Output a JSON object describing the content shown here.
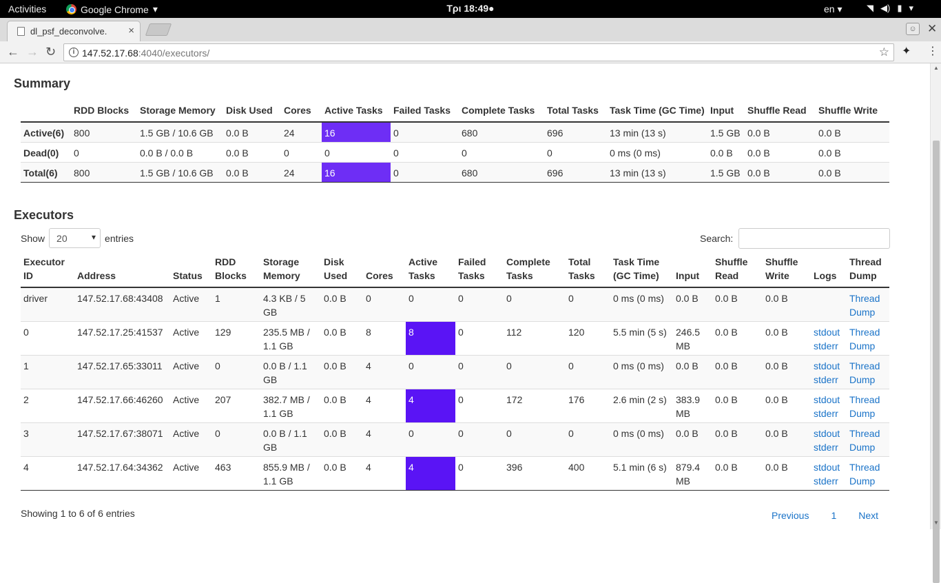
{
  "system": {
    "activities": "Activities",
    "app_name": "Google Chrome",
    "clock": "Τρι 18:49●",
    "language": "en"
  },
  "browser": {
    "tab_title": "dl_psf_deconvolve.",
    "url_host": "147.52.17.68",
    "url_rest": ":4040/executors/"
  },
  "summary": {
    "title": "Summary",
    "headers": [
      "",
      "RDD Blocks",
      "Storage Memory",
      "Disk Used",
      "Cores",
      "Active Tasks",
      "Failed Tasks",
      "Complete Tasks",
      "Total Tasks",
      "Task Time (GC Time)",
      "Input",
      "Shuffle Read",
      "Shuffle Write"
    ],
    "rows": [
      [
        "Active(6)",
        "800",
        "1.5 GB / 10.6 GB",
        "0.0 B",
        "24",
        "16",
        "0",
        "680",
        "696",
        "13 min (13 s)",
        "1.5 GB",
        "0.0 B",
        "0.0 B"
      ],
      [
        "Dead(0)",
        "0",
        "0.0 B / 0.0 B",
        "0.0 B",
        "0",
        "0",
        "0",
        "0",
        "0",
        "0 ms (0 ms)",
        "0.0 B",
        "0.0 B",
        "0.0 B"
      ],
      [
        "Total(6)",
        "800",
        "1.5 GB / 10.6 GB",
        "0.0 B",
        "24",
        "16",
        "0",
        "680",
        "696",
        "13 min (13 s)",
        "1.5 GB",
        "0.0 B",
        "0.0 B"
      ]
    ]
  },
  "executors": {
    "title": "Executors",
    "show_label": "Show",
    "entries_label": "entries",
    "page_size": "20",
    "search_label": "Search:",
    "headers": [
      "Executor ID",
      "Address",
      "Status",
      "RDD Blocks",
      "Storage Memory",
      "Disk Used",
      "Cores",
      "Active Tasks",
      "Failed Tasks",
      "Complete Tasks",
      "Total Tasks",
      "Task Time (GC Time)",
      "Input",
      "Shuffle Read",
      "Shuffle Write",
      "Logs",
      "Thread Dump"
    ],
    "rows": [
      [
        "driver",
        "147.52.17.68:43408",
        "Active",
        "1",
        "4.3 KB / 5 GB",
        "0.0 B",
        "0",
        "0",
        "0",
        "0",
        "0",
        "0 ms (0 ms)",
        "0.0 B",
        "0.0 B",
        "0.0 B",
        "",
        "Thread Dump"
      ],
      [
        "0",
        "147.52.17.25:41537",
        "Active",
        "129",
        "235.5 MB / 1.1 GB",
        "0.0 B",
        "8",
        "8",
        "0",
        "112",
        "120",
        "5.5 min (5 s)",
        "246.5 MB",
        "0.0 B",
        "0.0 B",
        "stdout stderr",
        "Thread Dump"
      ],
      [
        "1",
        "147.52.17.65:33011",
        "Active",
        "0",
        "0.0 B / 1.1 GB",
        "0.0 B",
        "4",
        "0",
        "0",
        "0",
        "0",
        "0 ms (0 ms)",
        "0.0 B",
        "0.0 B",
        "0.0 B",
        "stdout stderr",
        "Thread Dump"
      ],
      [
        "2",
        "147.52.17.66:46260",
        "Active",
        "207",
        "382.7 MB / 1.1 GB",
        "0.0 B",
        "4",
        "4",
        "0",
        "172",
        "176",
        "2.6 min (2 s)",
        "383.9 MB",
        "0.0 B",
        "0.0 B",
        "stdout stderr",
        "Thread Dump"
      ],
      [
        "3",
        "147.52.17.67:38071",
        "Active",
        "0",
        "0.0 B / 1.1 GB",
        "0.0 B",
        "4",
        "0",
        "0",
        "0",
        "0",
        "0 ms (0 ms)",
        "0.0 B",
        "0.0 B",
        "0.0 B",
        "stdout stderr",
        "Thread Dump"
      ],
      [
        "4",
        "147.52.17.64:34362",
        "Active",
        "463",
        "855.9 MB / 1.1 GB",
        "0.0 B",
        "4",
        "4",
        "0",
        "396",
        "400",
        "5.1 min (6 s)",
        "879.4 MB",
        "0.0 B",
        "0.0 B",
        "stdout stderr",
        "Thread Dump"
      ]
    ],
    "footer_info": "Showing 1 to 6 of 6 entries",
    "pager": {
      "previous": "Previous",
      "page": "1",
      "next": "Next"
    }
  },
  "colors": {
    "active_bar": "#6e2ef5",
    "link": "#1a73c8"
  }
}
